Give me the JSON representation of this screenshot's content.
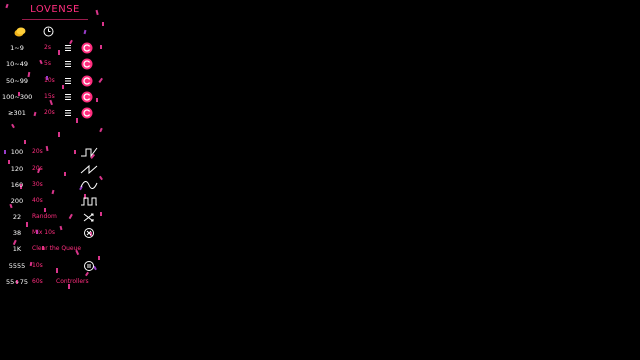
{
  "app": {
    "brand": "LOVENSE",
    "accent_color": "#ff2d7e",
    "background_color": "#000000"
  },
  "header": {
    "icons": [
      "coin-icon",
      "clock-icon"
    ]
  },
  "level_rows": [
    {
      "range": "1~9",
      "duration": "2s",
      "icon": "menu-lines-icon",
      "badge": "lovense-badge-icon"
    },
    {
      "range": "10~49",
      "duration": "5s",
      "icon": "menu-lines-icon",
      "badge": "lovense-badge-icon"
    },
    {
      "range": "50~99",
      "duration": "10s",
      "icon": "menu-lines-icon",
      "badge": "lovense-badge-icon"
    },
    {
      "range": "100~300",
      "duration": "15s",
      "icon": "menu-lines-icon",
      "badge": "lovense-badge-icon"
    },
    {
      "range": "≥301",
      "duration": "20s",
      "icon": "menu-lines-icon",
      "badge": "lovense-badge-icon"
    }
  ],
  "special_rows": [
    {
      "value": "100",
      "text": "20s",
      "icon": "pulse-wave-icon"
    },
    {
      "value": "120",
      "text": "20s",
      "icon": "zigzag-wave-icon"
    },
    {
      "value": "160",
      "text": "30s",
      "icon": "sine-wave-icon"
    },
    {
      "value": "200",
      "text": "40s",
      "icon": "square-wave-icon"
    },
    {
      "value": "22",
      "text": "Random",
      "icon": "shuffle-icon"
    },
    {
      "value": "38",
      "text": "Mix 10s",
      "icon": "close-circle-icon"
    },
    {
      "value": "1K",
      "text": "Clear the Queue",
      "icon": ""
    },
    {
      "value": "5555",
      "text": "10s",
      "icon": "pause-circle-icon"
    },
    {
      "value": "55~75",
      "text": "60s",
      "text2": "Controllers",
      "icon": ""
    }
  ]
}
